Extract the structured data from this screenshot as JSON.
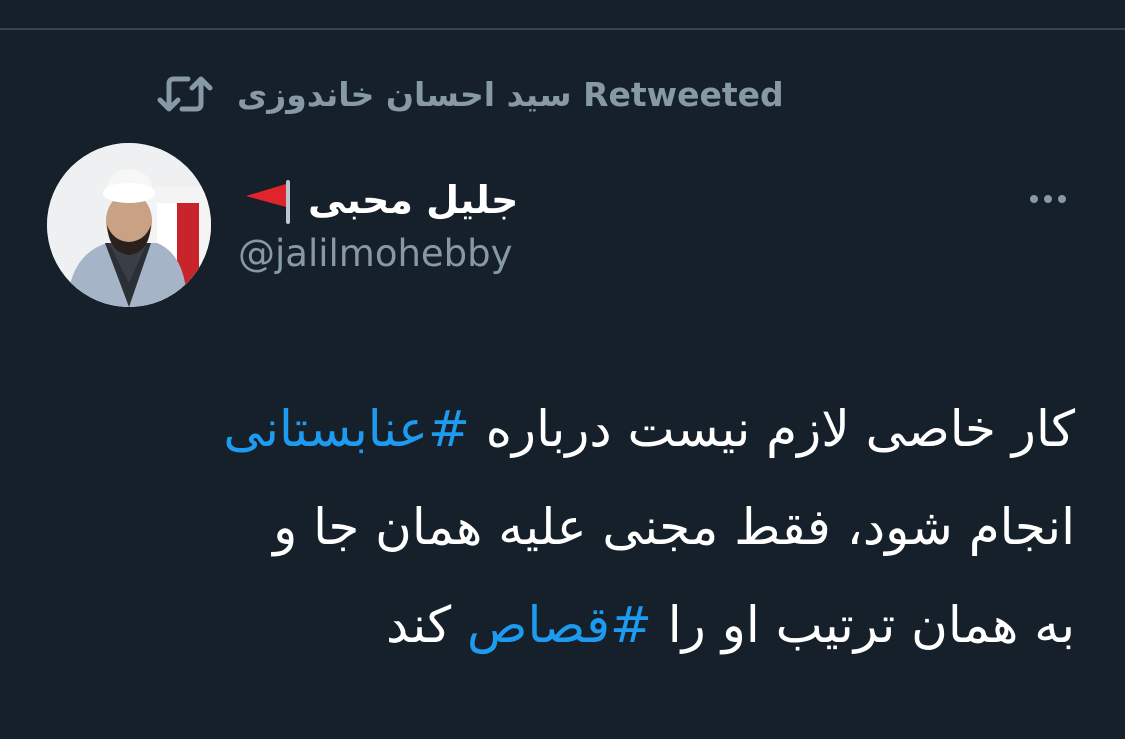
{
  "retweet": {
    "icon": "retweet-icon",
    "text": "سید احسان خاندوزی Retweeted"
  },
  "author": {
    "avatar_icon": "profile-photo",
    "display_name": "جلیل محبی",
    "flag_icon": "red-flag-emoji",
    "handle": "@jalilmohebby"
  },
  "more_menu_icon": "ellipsis-icon",
  "tweet": {
    "line1_text": "کار خاصی لازم نیست درباره ",
    "line1_hashtag": "#عنابستانی",
    "line2_text": "انجام شود، فقط مجنی علیه همان جا و",
    "line3_text": "به همان ترتیب او را ",
    "line3_hashtag": "#قصاص",
    "line3_tail": " کند"
  },
  "colors": {
    "background": "#15202b",
    "secondary_text": "#8899a6",
    "hashtag": "#1d9bf0",
    "primary_text": "#ffffff",
    "flag": "#e0242b"
  }
}
